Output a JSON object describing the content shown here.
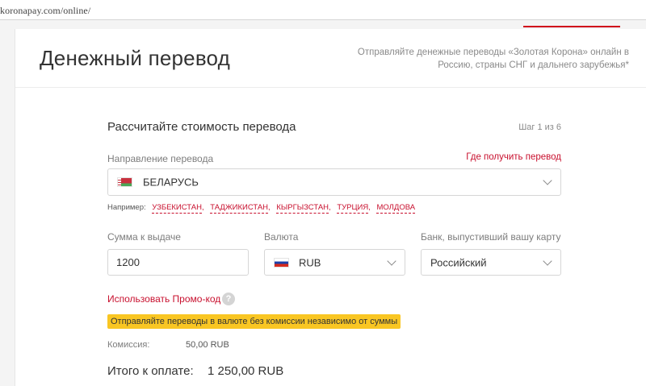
{
  "browser": {
    "url": "koronapay.com/online/"
  },
  "header": {
    "title": "Денежный перевод",
    "tagline_line1": "Отправляйте денежные переводы «Золотая Корона» онлайн в",
    "tagline_line2": "Россию, страны СНГ и дальнего зарубежья*"
  },
  "form": {
    "title": "Рассчитайте стоимость перевода",
    "step": "Шаг 1 из 6",
    "direction": {
      "label": "Направление перевода",
      "where_link": "Где получить перевод",
      "value": "БЕЛАРУСЬ",
      "flag_icon": "belarus-flag-icon"
    },
    "examples": {
      "prefix": "Например:",
      "items": [
        "УЗБЕКИСТАН",
        "ТАДЖИКИСТАН",
        "КЫРГЫЗСТАН",
        "ТУРЦИЯ",
        "МОЛДОВА"
      ]
    },
    "amount": {
      "label": "Сумма к выдаче",
      "value": "1200"
    },
    "currency": {
      "label": "Валюта",
      "value": "RUB",
      "flag_icon": "russia-flag-icon"
    },
    "bank": {
      "label": "Банк, выпустивший вашу карту",
      "value": "Российский"
    },
    "promo": {
      "label": "Использовать Промо-код",
      "help": "?"
    },
    "banner": "Отправляйте переводы в валюте без комиссии независимо от суммы",
    "fee": {
      "label": "Комиссия:",
      "value": "50,00 RUB"
    },
    "total": {
      "label": "Итого к оплате:",
      "value": "1 250,00 RUB"
    }
  },
  "colors": {
    "accent": "#c8102e",
    "banner": "#f9c623"
  }
}
